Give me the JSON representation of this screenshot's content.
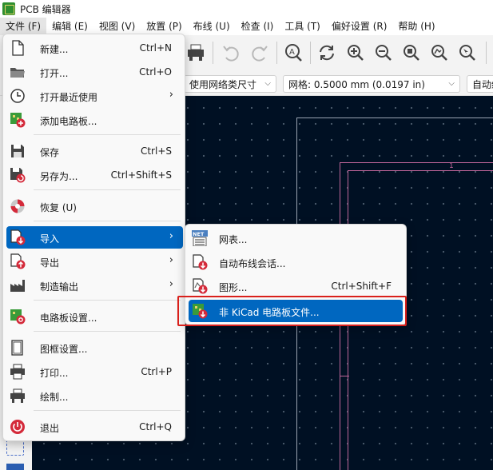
{
  "titlebar": {
    "title": "PCB 编辑器"
  },
  "menubar": {
    "items": [
      "文件 (F)",
      "编辑 (E)",
      "视图 (V)",
      "放置 (P)",
      "布线 (U)",
      "检查 (I)",
      "工具 (T)",
      "偏好设置 (R)",
      "帮助 (H)"
    ]
  },
  "toolbar2": {
    "track_width": "使用网络类尺寸",
    "grid": "网格: 0.5000 mm (0.0197 in)",
    "zoom": "自动缩"
  },
  "canvas": {
    "sheet_label": "1"
  },
  "file_menu": {
    "items": [
      {
        "label": "新建...",
        "shortcut": "Ctrl+N",
        "icon": "new-file-icon"
      },
      {
        "label": "打开...",
        "shortcut": "Ctrl+O",
        "icon": "open-folder-icon"
      },
      {
        "label": "打开最近使用",
        "shortcut": "",
        "icon": "clock-icon",
        "submenu": true
      },
      {
        "label": "添加电路板...",
        "shortcut": "",
        "icon": "add-board-icon"
      },
      {
        "label": "保存",
        "shortcut": "Ctrl+S",
        "icon": "save-icon"
      },
      {
        "label": "另存为...",
        "shortcut": "Ctrl+Shift+S",
        "icon": "save-as-icon"
      },
      {
        "label": "恢复 (U)",
        "shortcut": "",
        "icon": "revert-icon"
      },
      {
        "label": "导入",
        "shortcut": "",
        "icon": "import-icon",
        "submenu": true,
        "highlighted": true
      },
      {
        "label": "导出",
        "shortcut": "",
        "icon": "export-icon",
        "submenu": true
      },
      {
        "label": "制造输出",
        "shortcut": "",
        "icon": "factory-icon",
        "submenu": true
      },
      {
        "label": "电路板设置...",
        "shortcut": "",
        "icon": "board-setup-icon"
      },
      {
        "label": "图框设置...",
        "shortcut": "",
        "icon": "page-setup-icon"
      },
      {
        "label": "打印...",
        "shortcut": "Ctrl+P",
        "icon": "print-icon"
      },
      {
        "label": "绘制...",
        "shortcut": "",
        "icon": "plot-icon"
      },
      {
        "label": "退出",
        "shortcut": "Ctrl+Q",
        "icon": "exit-icon"
      }
    ],
    "submenu_arrow": "›"
  },
  "import_submenu": {
    "items": [
      {
        "label": "网表...",
        "shortcut": "",
        "icon": "netlist-icon"
      },
      {
        "label": "自动布线会话...",
        "shortcut": "",
        "icon": "autoroute-session-icon"
      },
      {
        "label": "图形...",
        "shortcut": "Ctrl+Shift+F",
        "icon": "graphics-import-icon"
      },
      {
        "label": "非 KiCad 电路板文件...",
        "shortcut": "",
        "icon": "non-kicad-board-icon",
        "highlighted": true
      }
    ]
  },
  "colors": {
    "highlight": "#0067c0",
    "canvas_bg": "#001023",
    "annotation_box": "#d9201b"
  }
}
